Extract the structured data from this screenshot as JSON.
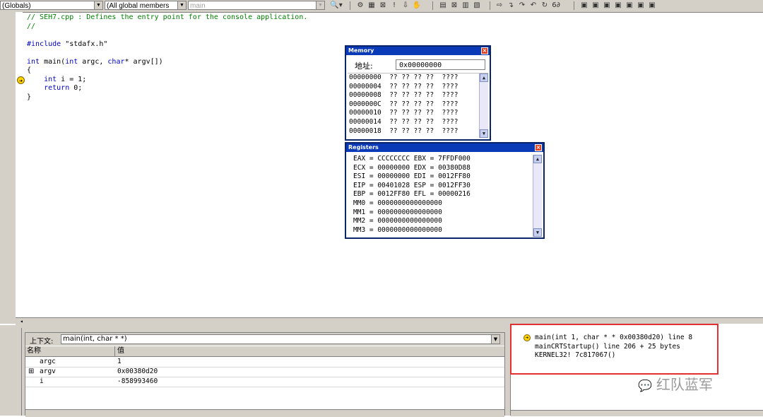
{
  "toolbar": {
    "scope_combo": "(Globals)",
    "members_combo": "(All global members",
    "function_combo": "main"
  },
  "editor": {
    "lines": [
      {
        "type": "comment",
        "text": "// SEH7.cpp : Defines the entry point for the console application."
      },
      {
        "type": "comment",
        "text": "//"
      },
      {
        "type": "blank",
        "text": ""
      },
      {
        "type": "include",
        "kw": "#include",
        "rest": " \"stdafx.h\""
      },
      {
        "type": "blank",
        "text": ""
      },
      {
        "type": "sig",
        "kw1": "int",
        "mid": " main(",
        "kw2": "int",
        "mid2": " argc, ",
        "kw3": "char",
        "rest": "* argv[])"
      },
      {
        "type": "plain",
        "text": "{"
      },
      {
        "type": "decl",
        "indent": "    ",
        "kw": "int",
        "rest": " i = 1;"
      },
      {
        "type": "decl",
        "indent": "    ",
        "kw": "return",
        "rest": " 0;"
      },
      {
        "type": "plain",
        "text": "}"
      }
    ]
  },
  "memory_window": {
    "title": "Memory",
    "address_label": "地址:",
    "address_value": "0x00000000",
    "rows": [
      "00000000  ?? ?? ?? ??  ????",
      "00000004  ?? ?? ?? ??  ????",
      "00000008  ?? ?? ?? ??  ????",
      "0000000C  ?? ?? ?? ??  ????",
      "00000010  ?? ?? ?? ??  ????",
      "00000014  ?? ?? ?? ??  ????",
      "00000018  ?? ?? ?? ??  ????"
    ]
  },
  "registers_window": {
    "title": "Registers",
    "rows": [
      "EAX = CCCCCCCC EBX = 7FFDF000",
      "ECX = 00000000 EDX = 00380D88",
      "ESI = 00000000 EDI = 0012FF80",
      "EIP = 00401028 ESP = 0012FF30",
      "EBP = 0012FF80 EFL = 00000216",
      "MM0 = 0000000000000000",
      "MM1 = 0000000000000000",
      "MM2 = 0000000000000000",
      "MM3 = 0000000000000000"
    ]
  },
  "variables": {
    "context_label": "上下文:",
    "context_value": "main(int, char * *)",
    "col_name": "名称",
    "col_value": "值",
    "rows": [
      {
        "expand": "",
        "name": "argc",
        "value": "1"
      },
      {
        "expand": "⊞",
        "name": "argv",
        "value": "0x00380d20"
      },
      {
        "expand": "",
        "name": "i",
        "value": "-858993460"
      }
    ]
  },
  "callstack": {
    "rows": [
      "main(int 1, char * * 0x00380d20) line 8",
      "mainCRTStartup() line 206 + 25 bytes",
      "KERNEL32! 7c817067()"
    ]
  },
  "watermark": "红队蓝军",
  "colors": {
    "highlight": "#e03030",
    "title_bar": "#0a3ab8",
    "comment": "#008000",
    "keyword": "#0000c0"
  }
}
